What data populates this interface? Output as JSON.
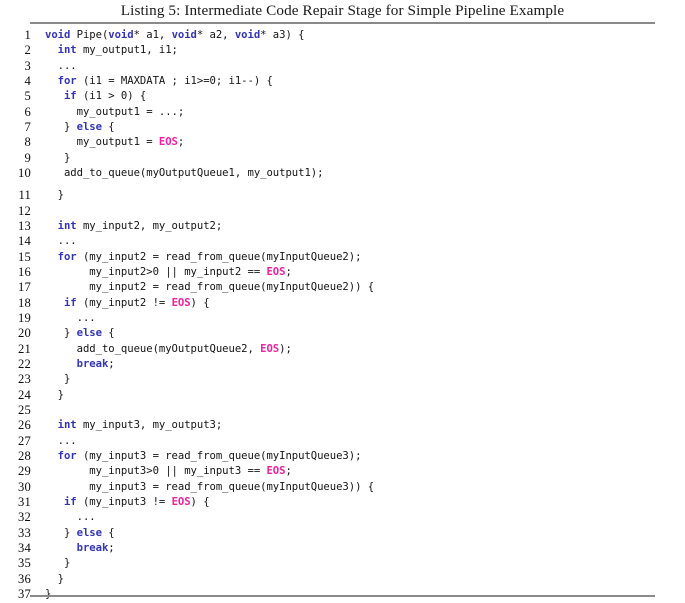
{
  "figure": {
    "caption": "Listing 5: Intermediate Code Repair Stage for Simple Pipeline Example",
    "listing_number": "5",
    "language": "C"
  },
  "colors": {
    "keyword": "#3333b8",
    "constant": "#f020a0",
    "plain": "#141414",
    "rule": "#8a8a8a",
    "background": "#ffffff"
  },
  "code": {
    "first_line_number": 1,
    "last_line_number": 37,
    "lines": [
      {
        "n": "1",
        "gap": false,
        "tokens": [
          {
            "t": "kw",
            "s": "void"
          },
          {
            "t": "pln",
            "s": " Pipe("
          },
          {
            "t": "kw",
            "s": "void"
          },
          {
            "t": "pln",
            "s": "* a1, "
          },
          {
            "t": "kw",
            "s": "void"
          },
          {
            "t": "pln",
            "s": "* a2, "
          },
          {
            "t": "kw",
            "s": "void"
          },
          {
            "t": "pln",
            "s": "* a3) {"
          }
        ]
      },
      {
        "n": "2",
        "gap": false,
        "tokens": [
          {
            "t": "pln",
            "s": "  "
          },
          {
            "t": "kw",
            "s": "int"
          },
          {
            "t": "pln",
            "s": " my_output1, i1;"
          }
        ]
      },
      {
        "n": "3",
        "gap": false,
        "tokens": [
          {
            "t": "pln",
            "s": "  ..."
          }
        ]
      },
      {
        "n": "4",
        "gap": false,
        "tokens": [
          {
            "t": "pln",
            "s": "  "
          },
          {
            "t": "kw",
            "s": "for"
          },
          {
            "t": "pln",
            "s": " (i1 = MAXDATA ; i1>=0; i1--) {"
          }
        ]
      },
      {
        "n": "5",
        "gap": false,
        "tokens": [
          {
            "t": "pln",
            "s": "   "
          },
          {
            "t": "kw",
            "s": "if"
          },
          {
            "t": "pln",
            "s": " (i1 > 0) {"
          }
        ]
      },
      {
        "n": "6",
        "gap": false,
        "tokens": [
          {
            "t": "pln",
            "s": "     my_output1 = ...;"
          }
        ]
      },
      {
        "n": "7",
        "gap": false,
        "tokens": [
          {
            "t": "pln",
            "s": "   } "
          },
          {
            "t": "kw",
            "s": "else"
          },
          {
            "t": "pln",
            "s": " {"
          }
        ]
      },
      {
        "n": "8",
        "gap": false,
        "tokens": [
          {
            "t": "pln",
            "s": "     my_output1 = "
          },
          {
            "t": "cst",
            "s": "EOS"
          },
          {
            "t": "pln",
            "s": ";"
          }
        ]
      },
      {
        "n": "9",
        "gap": false,
        "tokens": [
          {
            "t": "pln",
            "s": "   }"
          }
        ]
      },
      {
        "n": "10",
        "gap": false,
        "tokens": [
          {
            "t": "pln",
            "s": "   add_to_queue(myOutputQueue1, my_output1);"
          }
        ]
      },
      {
        "n": "11",
        "gap": true,
        "tokens": [
          {
            "t": "pln",
            "s": "  }"
          }
        ]
      },
      {
        "n": "12",
        "gap": false,
        "tokens": []
      },
      {
        "n": "13",
        "gap": false,
        "tokens": [
          {
            "t": "pln",
            "s": "  "
          },
          {
            "t": "kw",
            "s": "int"
          },
          {
            "t": "pln",
            "s": " my_input2, my_output2;"
          }
        ]
      },
      {
        "n": "14",
        "gap": false,
        "tokens": [
          {
            "t": "pln",
            "s": "  ..."
          }
        ]
      },
      {
        "n": "15",
        "gap": false,
        "tokens": [
          {
            "t": "pln",
            "s": "  "
          },
          {
            "t": "kw",
            "s": "for"
          },
          {
            "t": "pln",
            "s": " (my_input2 = read_from_queue(myInputQueue2);"
          }
        ]
      },
      {
        "n": "16",
        "gap": false,
        "tokens": [
          {
            "t": "pln",
            "s": "       my_input2>0 || my_input2 == "
          },
          {
            "t": "cst",
            "s": "EOS"
          },
          {
            "t": "pln",
            "s": ";"
          }
        ]
      },
      {
        "n": "17",
        "gap": false,
        "tokens": [
          {
            "t": "pln",
            "s": "       my_input2 = read_from_queue(myInputQueue2)) {"
          }
        ]
      },
      {
        "n": "18",
        "gap": false,
        "tokens": [
          {
            "t": "pln",
            "s": "   "
          },
          {
            "t": "kw",
            "s": "if"
          },
          {
            "t": "pln",
            "s": " (my_input2 != "
          },
          {
            "t": "cst",
            "s": "EOS"
          },
          {
            "t": "pln",
            "s": ") {"
          }
        ]
      },
      {
        "n": "19",
        "gap": false,
        "tokens": [
          {
            "t": "pln",
            "s": "     ..."
          }
        ]
      },
      {
        "n": "20",
        "gap": false,
        "tokens": [
          {
            "t": "pln",
            "s": "   } "
          },
          {
            "t": "kw",
            "s": "else"
          },
          {
            "t": "pln",
            "s": " {"
          }
        ]
      },
      {
        "n": "21",
        "gap": false,
        "tokens": [
          {
            "t": "pln",
            "s": "     add_to_queue(myOutputQueue2, "
          },
          {
            "t": "cst",
            "s": "EOS"
          },
          {
            "t": "pln",
            "s": ");"
          }
        ]
      },
      {
        "n": "22",
        "gap": false,
        "tokens": [
          {
            "t": "pln",
            "s": "     "
          },
          {
            "t": "kw",
            "s": "break"
          },
          {
            "t": "pln",
            "s": ";"
          }
        ]
      },
      {
        "n": "23",
        "gap": false,
        "tokens": [
          {
            "t": "pln",
            "s": "   }"
          }
        ]
      },
      {
        "n": "24",
        "gap": false,
        "tokens": [
          {
            "t": "pln",
            "s": "  }"
          }
        ]
      },
      {
        "n": "25",
        "gap": false,
        "tokens": []
      },
      {
        "n": "26",
        "gap": false,
        "tokens": [
          {
            "t": "pln",
            "s": "  "
          },
          {
            "t": "kw",
            "s": "int"
          },
          {
            "t": "pln",
            "s": " my_input3, my_output3;"
          }
        ]
      },
      {
        "n": "27",
        "gap": false,
        "tokens": [
          {
            "t": "pln",
            "s": "  ..."
          }
        ]
      },
      {
        "n": "28",
        "gap": false,
        "tokens": [
          {
            "t": "pln",
            "s": "  "
          },
          {
            "t": "kw",
            "s": "for"
          },
          {
            "t": "pln",
            "s": " (my_input3 = read_from_queue(myInputQueue3);"
          }
        ]
      },
      {
        "n": "29",
        "gap": false,
        "tokens": [
          {
            "t": "pln",
            "s": "       my_input3>0 || my_input3 == "
          },
          {
            "t": "cst",
            "s": "EOS"
          },
          {
            "t": "pln",
            "s": ";"
          }
        ]
      },
      {
        "n": "30",
        "gap": false,
        "tokens": [
          {
            "t": "pln",
            "s": "       my_input3 = read_from_queue(myInputQueue3)) {"
          }
        ]
      },
      {
        "n": "31",
        "gap": false,
        "tokens": [
          {
            "t": "pln",
            "s": "   "
          },
          {
            "t": "kw",
            "s": "if"
          },
          {
            "t": "pln",
            "s": " (my_input3 != "
          },
          {
            "t": "cst",
            "s": "EOS"
          },
          {
            "t": "pln",
            "s": ") {"
          }
        ]
      },
      {
        "n": "32",
        "gap": false,
        "tokens": [
          {
            "t": "pln",
            "s": "     ..."
          }
        ]
      },
      {
        "n": "33",
        "gap": false,
        "tokens": [
          {
            "t": "pln",
            "s": "   } "
          },
          {
            "t": "kw",
            "s": "else"
          },
          {
            "t": "pln",
            "s": " {"
          }
        ]
      },
      {
        "n": "34",
        "gap": false,
        "tokens": [
          {
            "t": "pln",
            "s": "     "
          },
          {
            "t": "kw",
            "s": "break"
          },
          {
            "t": "pln",
            "s": ";"
          }
        ]
      },
      {
        "n": "35",
        "gap": false,
        "tokens": [
          {
            "t": "pln",
            "s": "   }"
          }
        ]
      },
      {
        "n": "36",
        "gap": false,
        "tokens": [
          {
            "t": "pln",
            "s": "  }"
          }
        ]
      },
      {
        "n": "37",
        "gap": false,
        "tokens": [
          {
            "t": "pln",
            "s": "}"
          }
        ]
      }
    ]
  }
}
